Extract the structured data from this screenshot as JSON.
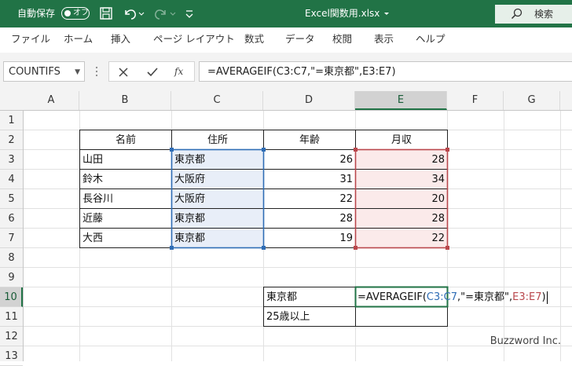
{
  "titlebar": {
    "autosave_label": "自動保存",
    "autosave_state": "オフ",
    "filename": "Excel関数用.xlsx",
    "search_label": "検索",
    "accent_color": "#217346"
  },
  "ribbon": {
    "tabs": [
      "ファイル",
      "ホーム",
      "挿入",
      "ページ レイアウト",
      "数式",
      "データ",
      "校閲",
      "表示",
      "ヘルプ"
    ]
  },
  "formula_bar": {
    "name_box": "COUNTIFS",
    "formula": "=AVERAGEIF(C3:C7,\"=東京都\",E3:E7)"
  },
  "columns": [
    "A",
    "B",
    "C",
    "D",
    "E",
    "F",
    "G"
  ],
  "selected_column": "E",
  "rows": [
    "1",
    "2",
    "3",
    "4",
    "5",
    "6",
    "7",
    "8",
    "9",
    "10",
    "11",
    "12",
    "13"
  ],
  "selected_row": "10",
  "table": {
    "headers": [
      "名前",
      "住所",
      "年齢",
      "月収"
    ],
    "rows": [
      [
        "山田",
        "東京都",
        "26",
        "28"
      ],
      [
        "鈴木",
        "大阪府",
        "31",
        "34"
      ],
      [
        "長谷川",
        "大阪府",
        "22",
        "20"
      ],
      [
        "近藤",
        "東京都",
        "28",
        "28"
      ],
      [
        "大西",
        "東京都",
        "19",
        "22"
      ]
    ]
  },
  "criteria": {
    "d10": "東京都",
    "d11": "25歳以上"
  },
  "edit_formula": {
    "prefix": "=AVERAGEIF(",
    "range1": "C3:C7",
    "middle": ",\"=東京都\",",
    "range2": "E3:E7",
    "suffix": ")"
  },
  "range_colors": {
    "range1_border": "#2f6db5",
    "range1_fill": "#e8eef8",
    "range2_border": "#b9474c",
    "range2_fill": "#fbeaea"
  },
  "watermark": "Buzzword Inc."
}
